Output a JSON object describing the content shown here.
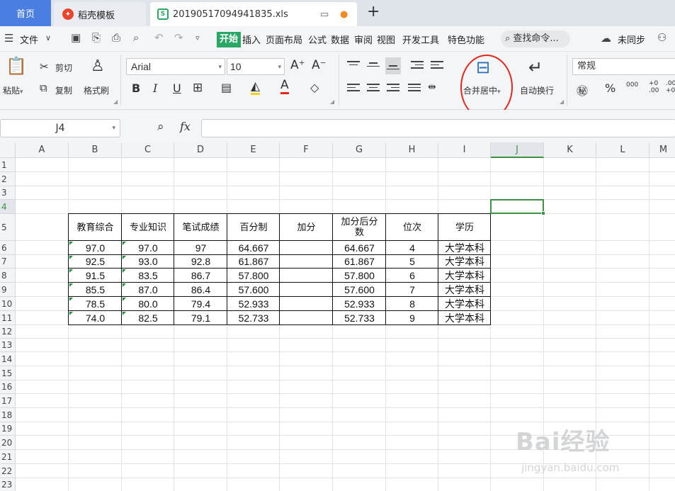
{
  "tabs": {
    "home": "首页",
    "template": "稻壳模板",
    "file": "20190517094941835.xls",
    "add": "+"
  },
  "menu": {
    "file": "文件",
    "items": [
      "开始",
      "插入",
      "页面布局",
      "公式",
      "数据",
      "审阅",
      "视图",
      "开发工具",
      "特色功能"
    ],
    "search": "查找命令...",
    "sync": "未同步"
  },
  "ribbon": {
    "paste": "粘贴",
    "cut": "剪切",
    "copy": "复制",
    "format_painter": "格式刷",
    "font_name": "Arial",
    "font_size": "10",
    "merge_center": "合并居中",
    "wrap_text": "自动换行",
    "number_format": "常规",
    "percent": "%",
    "thousands": "000",
    "inc_decimal": "+0 .00",
    "dec_decimal": ".00 +0"
  },
  "formula_bar": {
    "name_box": "J4",
    "fx": "fx",
    "value": ""
  },
  "columns": [
    "A",
    "B",
    "C",
    "D",
    "E",
    "F",
    "G",
    "H",
    "I",
    "J",
    "K",
    "L",
    "M"
  ],
  "rows": [
    "1",
    "2",
    "3",
    "4",
    "5",
    "6",
    "7",
    "8",
    "9",
    "10",
    "11",
    "12",
    "13",
    "14",
    "15",
    "16",
    "17",
    "18",
    "19",
    "20",
    "21",
    "22",
    "23"
  ],
  "table": {
    "headers": [
      "教育综合",
      "专业知识",
      "笔试成绩",
      "百分制",
      "加分",
      "加分后分数",
      "位次",
      "学历"
    ],
    "rows": [
      [
        "97.0",
        "97.0",
        "97",
        "64.667",
        "",
        "64.667",
        "4",
        "大学本科"
      ],
      [
        "92.5",
        "93.0",
        "92.8",
        "61.867",
        "",
        "61.867",
        "5",
        "大学本科"
      ],
      [
        "91.5",
        "83.5",
        "86.7",
        "57.800",
        "",
        "57.800",
        "6",
        "大学本科"
      ],
      [
        "85.5",
        "87.0",
        "86.4",
        "57.600",
        "",
        "57.600",
        "7",
        "大学本科"
      ],
      [
        "78.5",
        "80.0",
        "79.4",
        "52.933",
        "",
        "52.933",
        "8",
        "大学本科"
      ],
      [
        "74.0",
        "82.5",
        "79.1",
        "52.733",
        "",
        "52.733",
        "9",
        "大学本科"
      ]
    ]
  },
  "selection": {
    "active_cell": "J4"
  },
  "watermark": {
    "brand": "Bai经验",
    "url": "jingyan.baidu.com"
  },
  "colors": {
    "accent": "#2aa764",
    "home_tab": "#4a7ee0",
    "selection": "#3f9145",
    "annotation_circle": "#e4261b"
  }
}
